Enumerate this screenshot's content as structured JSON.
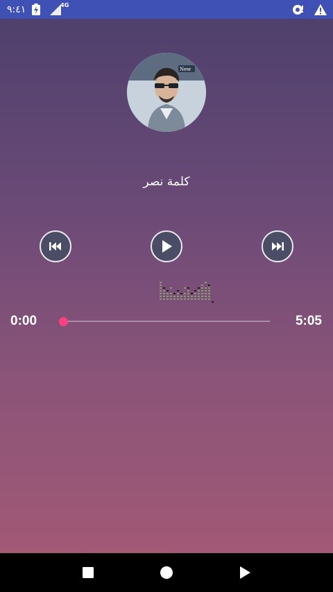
{
  "status_bar": {
    "time": "٩:٤١",
    "network": "4G",
    "icons": [
      "battery-charging-icon",
      "signal-icon",
      "cast-icon",
      "warning-icon"
    ]
  },
  "player": {
    "song_title": "كلمة نصر",
    "album_art_icon": "album-art-image",
    "time_current": "0:00",
    "time_total": "5:05",
    "progress": 0.0,
    "controls": {
      "previous_icon": "skip-previous-icon",
      "play_icon": "play-icon",
      "next_icon": "skip-next-icon"
    }
  },
  "navigation": {
    "icons": [
      "recents-square-icon",
      "home-circle-icon",
      "back-triangle-icon"
    ]
  },
  "colors": {
    "status_bar": "#3f51b5",
    "accent": "#ff4081",
    "button_fill": "#4a4d65"
  }
}
